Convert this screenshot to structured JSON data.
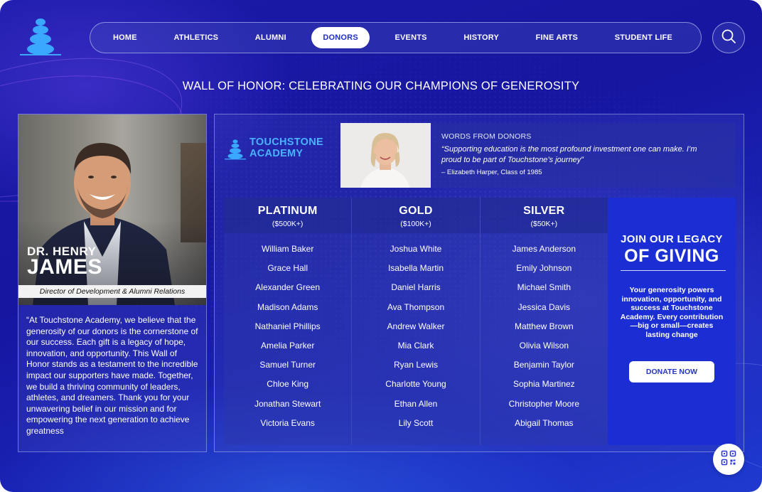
{
  "nav": {
    "items": [
      {
        "label": "HOME"
      },
      {
        "label": "ATHLETICS"
      },
      {
        "label": "ALUMNI"
      },
      {
        "label": "DONORS",
        "active": true
      },
      {
        "label": "EVENTS"
      },
      {
        "label": "HISTORY"
      },
      {
        "label": "FINE ARTS"
      },
      {
        "label": "STUDENT LIFE"
      }
    ],
    "search_icon": "search-icon"
  },
  "page": {
    "title": "WALL OF HONOR: CELEBRATING OUR CHAMPIONS OF GENEROSITY"
  },
  "profile": {
    "name_prefix": "DR. HENRY",
    "name_main": "JAMES",
    "role": "Director of Development & Alumni Relations",
    "quote": "“At Touchstone Academy, we believe that the generosity of our donors is the cornerstone of our success. Each gift is a legacy of hope, innovation, and opportunity. This Wall of Honor stands as a testament to the incredible impact our supporters have made. Together, we build a thriving community of leaders, athletes, and dreamers. Thank you for your unwavering belief in our mission and for empowering the next generation to achieve greatness"
  },
  "brand": {
    "line1": "TOUCHSTONE",
    "line2": "ACADEMY"
  },
  "testimonial": {
    "label": "WORDS FROM DONORS",
    "quote": "“Supporting education is the most profound investment one can make. I’m proud to be part of Touchstone’s journey”",
    "author": "– Elizabeth Harper, Class of 1985"
  },
  "tiers": [
    {
      "name": "PLATINUM",
      "range": "($500K+)",
      "donors": [
        "William Baker",
        "Grace Hall",
        "Alexander Green",
        "Madison Adams",
        "Nathaniel Phillips",
        "Amelia Parker",
        "Samuel Turner",
        "Chloe King",
        "Jonathan Stewart",
        "Victoria Evans"
      ]
    },
    {
      "name": "GOLD",
      "range": "($100K+)",
      "donors": [
        "Joshua White",
        "Isabella Martin",
        "Daniel Harris",
        "Ava Thompson",
        "Andrew Walker",
        "Mia Clark",
        "Ryan Lewis",
        "Charlotte Young",
        "Ethan Allen",
        "Lily Scott"
      ]
    },
    {
      "name": "SILVER",
      "range": "($50K+)",
      "donors": [
        "James Anderson",
        "Emily Johnson",
        "Michael Smith",
        "Jessica Davis",
        "Matthew Brown",
        "Olivia Wilson",
        "Benjamin Taylor",
        "Sophia Martinez",
        "Christopher Moore",
        "Abigail Thomas"
      ]
    }
  ],
  "cta": {
    "line1": "JOIN OUR LEGACY",
    "line2": "OF GIVING",
    "body": "Your generosity powers innovation, opportunity, and success at Touchstone Academy. Every contribution —big or small—creates lasting change",
    "button": "DONATE NOW"
  },
  "colors": {
    "accent": "#4ab2ff",
    "background": "#1a1aa8",
    "cta_panel": "#1a2ed4"
  },
  "icons": {
    "logo": "stacked-stones-logo",
    "qr": "qr-code-icon"
  }
}
